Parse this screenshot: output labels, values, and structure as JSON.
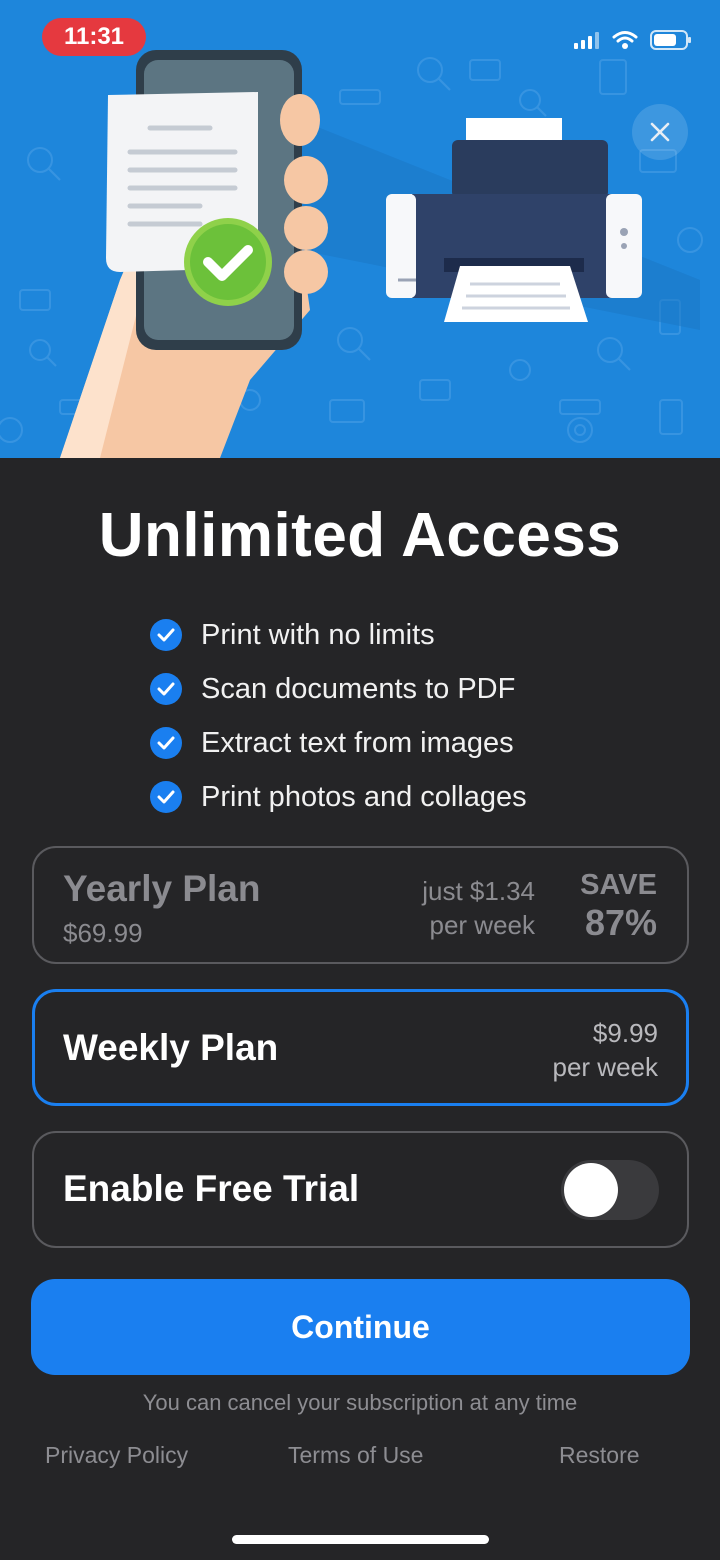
{
  "status_bar": {
    "time": "11:31"
  },
  "hero": {
    "close_icon": "close-icon",
    "colors": {
      "background": "#1e86db"
    }
  },
  "title": "Unlimited Access",
  "features": [
    "Print with no limits",
    "Scan documents to PDF",
    "Extract text from images",
    "Print photos and collages"
  ],
  "plans": {
    "yearly": {
      "name": "Yearly Plan",
      "price": "$69.99",
      "per_week_line1": "just $1.34",
      "per_week_line2": "per week",
      "save_label": "SAVE",
      "save_percent": "87%",
      "selected": false
    },
    "weekly": {
      "name": "Weekly Plan",
      "price": "$9.99",
      "period": "per week",
      "selected": true
    }
  },
  "trial": {
    "label": "Enable Free Trial",
    "enabled": false
  },
  "continue_label": "Continue",
  "cancel_note": "You can cancel your subscription at any time",
  "footer_links": {
    "privacy": "Privacy Policy",
    "terms": "Terms of Use",
    "restore": "Restore"
  },
  "colors": {
    "accent": "#1a7ff0",
    "background": "#252527"
  }
}
